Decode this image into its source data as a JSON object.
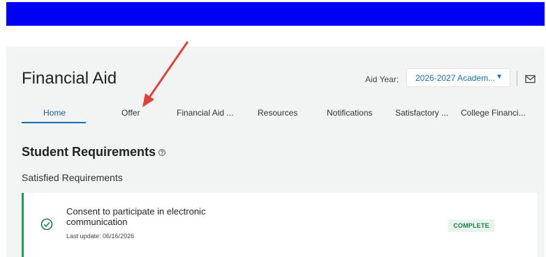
{
  "header": {
    "title": "Financial Aid",
    "aid_year_label": "Aid Year:",
    "aid_year_value": "2026-2027 Academ..."
  },
  "tabs": [
    {
      "label": "Home"
    },
    {
      "label": "Offer"
    },
    {
      "label": "Financial Aid ..."
    },
    {
      "label": "Resources"
    },
    {
      "label": "Notifications"
    },
    {
      "label": "Satisfactory ..."
    },
    {
      "label": "College Financi..."
    }
  ],
  "requirements": {
    "title": "Student Requirements",
    "help_icon": "help-circle-icon",
    "satisfied_title": "Satisfied Requirements",
    "items": [
      {
        "label": "Consent to participate in electronic communication",
        "last_update": "Last update: 06/16/2026",
        "status": "COMPLETE",
        "icon": "check-circle-icon"
      }
    ]
  },
  "colors": {
    "banner": "#0000f5",
    "accent": "#1a6fb3",
    "success": "#1a9c5b",
    "annotation_arrow": "#e0423a"
  }
}
